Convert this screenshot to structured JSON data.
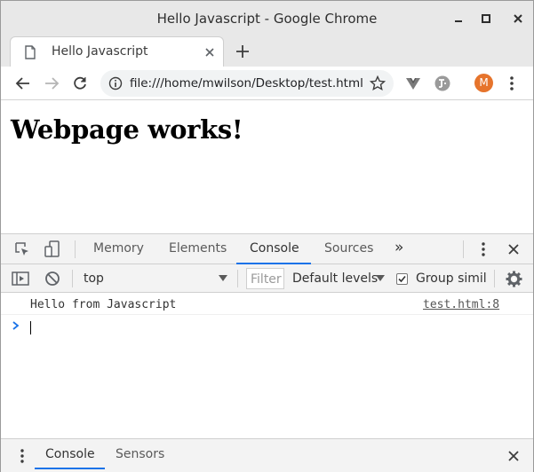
{
  "window": {
    "title": "Hello Javascript - Google Chrome"
  },
  "tab": {
    "title": "Hello Javascript"
  },
  "toolbar": {
    "url": "file:///home/mwilson/Desktop/test.html",
    "avatar_letter": "M"
  },
  "page": {
    "heading": "Webpage works!"
  },
  "devtools": {
    "tabs": [
      {
        "label": "Memory"
      },
      {
        "label": "Elements"
      },
      {
        "label": "Console",
        "active": true
      },
      {
        "label": "Sources"
      }
    ],
    "more_tabs": "»",
    "context": "top",
    "filter_placeholder": "Filter",
    "levels": "Default levels",
    "group_similar": "Group similar",
    "group_similar_checked": true,
    "logs": [
      {
        "message": "Hello from Javascript",
        "source": "test.html:8"
      }
    ],
    "drawer_tabs": [
      {
        "label": "Console",
        "active": true
      },
      {
        "label": "Sensors"
      }
    ]
  },
  "colors": {
    "accent": "#1a73e8",
    "avatar": "#e6742c",
    "prompt": "#1a73e8"
  }
}
